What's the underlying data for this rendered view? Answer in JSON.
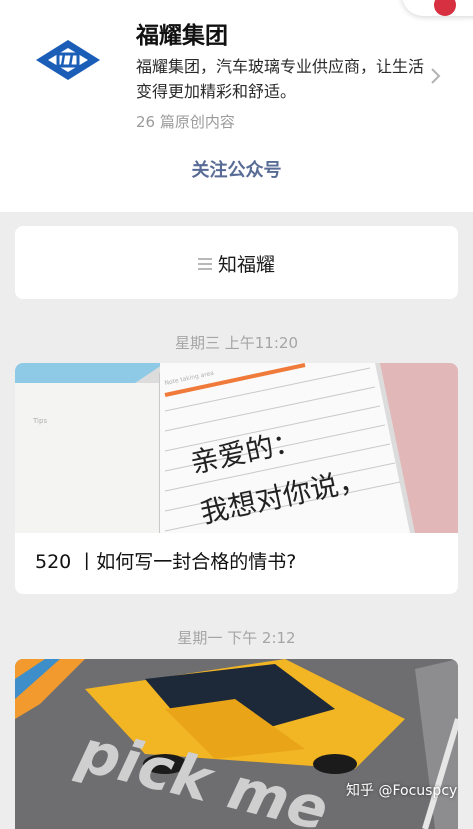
{
  "account": {
    "name": "福耀集团",
    "description": "福耀集团，汽车玻璃专业供应商，让生活变得更加精彩和舒适。",
    "original_count": "26 篇原创内容",
    "follow_label": "关注公众号"
  },
  "menu": {
    "label": "知福耀"
  },
  "feed": [
    {
      "timestamp": "星期三 上午11:20",
      "title": "520 丨如何写一封合格的情书?",
      "image_text": {
        "note_header": "Note taking area",
        "tips": "Tips",
        "line1": "亲爱的：",
        "line2": "我想对你说，"
      }
    },
    {
      "timestamp": "星期一 下午 2:12",
      "image_text": {
        "road_text": "pick me"
      }
    }
  ],
  "watermark": "知乎 @Focuspcy",
  "colors": {
    "link": "#576b95",
    "background": "#ededed",
    "brand_blue": "#1a5eb8"
  }
}
